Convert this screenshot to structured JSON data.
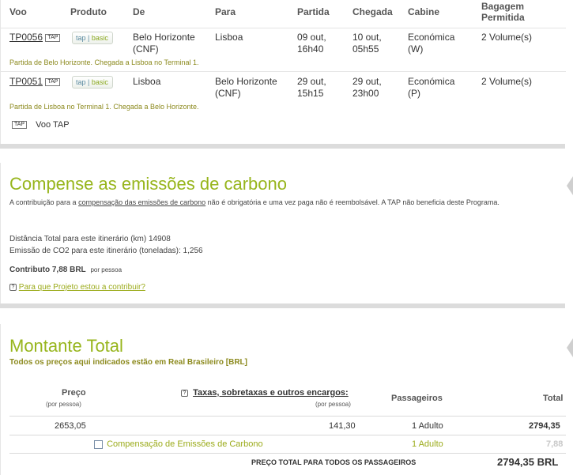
{
  "flights": {
    "headers": {
      "voo": "Voo",
      "produto": "Produto",
      "de": "De",
      "para": "Para",
      "partida": "Partida",
      "chegada": "Chegada",
      "cabine": "Cabine",
      "bagagem_1": "Bagagem",
      "bagagem_2": "Permitida"
    },
    "rows": [
      {
        "flight": "TP0056",
        "tap_badge": "TAP",
        "product_brand": "tap",
        "product_fare": "basic",
        "from_1": "Belo Horizonte",
        "from_2": "(CNF)",
        "to_1": "Lisboa",
        "to_2": "",
        "dep_1": "09 out,",
        "dep_2": "16h40",
        "arr_1": "10 out,",
        "arr_2": "05h55",
        "cabin_1": "Económica",
        "cabin_2": "(W)",
        "baggage": "2 Volume(s)",
        "note": "Partida de Belo Horizonte. Chegada a Lisboa no Terminal 1."
      },
      {
        "flight": "TP0051",
        "tap_badge": "TAP",
        "product_brand": "tap",
        "product_fare": "basic",
        "from_1": "Lisboa",
        "from_2": "",
        "to_1": "Belo Horizonte",
        "to_2": "(CNF)",
        "dep_1": "29 out,",
        "dep_2": "15h15",
        "arr_1": "29 out,",
        "arr_2": "23h00",
        "cabin_1": "Económica",
        "cabin_2": "(P)",
        "baggage": "2 Volume(s)",
        "note": "Partida de Lisboa no Terminal 1. Chegada a Belo Horizonte."
      }
    ],
    "legend_badge": "TAP",
    "legend_label": "Voo TAP"
  },
  "carbon": {
    "title": "Compense as emissões de carbono",
    "intro_pre": "A contribuição para a ",
    "intro_link": "compensação das emissões de carbono",
    "intro_post": " não é obrigatória e uma vez paga não é reembolsável. A TAP não beneficia deste Programa.",
    "distance": "Distância Total para este itinerário (km) 14908",
    "emission": "Emissão de CO2 para este itinerário (toneladas): 1,256",
    "contribution_label": "Contributo 7,88 BRL",
    "contribution_unit": "por pessoa",
    "help_icon": "?",
    "project_link": "Para que Projeto estou a contribuir?"
  },
  "total": {
    "title": "Montante Total",
    "subtitle": "Todos os preços aqui indicados estão em Real Brasileiro [BRL]",
    "col_price": "Preço",
    "col_price_sub": "(por pessoa)",
    "col_taxes": "Taxas, sobretaxas e outros encargos:",
    "col_taxes_sub": "(por pessoa)",
    "col_passengers": "Passageiros",
    "col_total": "Total",
    "help_icon": "?",
    "row1": {
      "price": "2653,05",
      "taxes": "141,30",
      "passengers": "1 Adulto",
      "total": "2794,35"
    },
    "row2": {
      "label": "Compensação de Emissões de Carbono",
      "passengers": "1 Adulto",
      "total": "7,88"
    },
    "grand_label": "PREÇO TOTAL PARA TODOS OS PASSAGEIROS",
    "grand_total": "2794,35 BRL"
  },
  "colors": {
    "accent_green": "#97b51c",
    "note_olive": "#8c8a1e"
  }
}
